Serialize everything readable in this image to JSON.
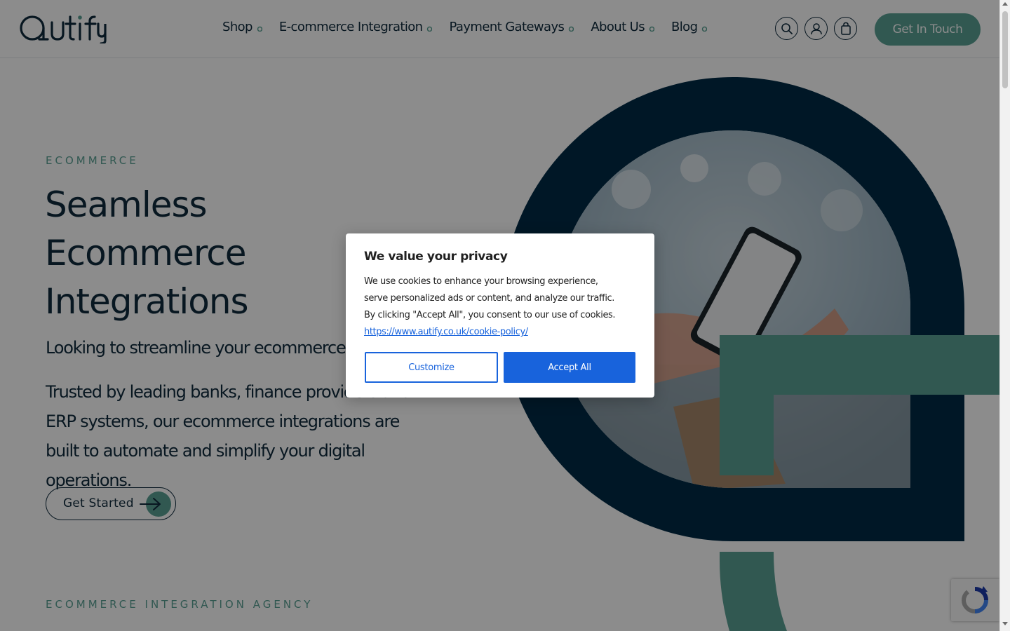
{
  "brand": {
    "name": "Autify",
    "logo_icon": "autify-logo"
  },
  "nav": {
    "items": [
      {
        "label": "Shop",
        "icon": "dropdown-dot-icon"
      },
      {
        "label": "E-commerce Integration",
        "icon": "dropdown-dot-icon"
      },
      {
        "label": "Payment Gateways",
        "icon": "dropdown-dot-icon"
      },
      {
        "label": "About Us",
        "icon": "dropdown-dot-icon"
      },
      {
        "label": "Blog",
        "icon": "dropdown-dot-icon"
      }
    ],
    "icons": [
      "search-icon",
      "account-icon",
      "cart-icon"
    ],
    "cta_label": "Get In Touch"
  },
  "hero": {
    "eyebrow": "ECOMMERCE",
    "title_lines": [
      "Seamless",
      "Ecommerce",
      "Integrations"
    ],
    "lead": "Looking to streamline your ecommerce pro",
    "body": "Trusted by leading banks, finance providers and ERP systems, our ecommerce integrations are built to automate and simplify your digital operations.",
    "cta_label": "Get Started",
    "cta_icon": "arrow-right-icon"
  },
  "section2": {
    "eyebrow": "ECOMMERCE INTEGRATION AGENCY"
  },
  "cookie_dialog": {
    "title": "We value your privacy",
    "body": "We use cookies to enhance your browsing experience, serve personalized ads or content, and analyze our traffic. By clicking \"Accept All\", you consent to our use of cookies.",
    "link": "https://www.autify.co.uk/cookie-policy/",
    "customize_label": "Customize",
    "accept_label": "Accept All"
  },
  "colors": {
    "navy": "#0f2a3c",
    "dark_navy": "#012b45",
    "teal": "#59a094",
    "cookie_blue": "#1863dc",
    "overlay": "rgba(0,0,0,0.45)"
  },
  "widgets": {
    "recaptcha_icon": "recaptcha-icon"
  }
}
